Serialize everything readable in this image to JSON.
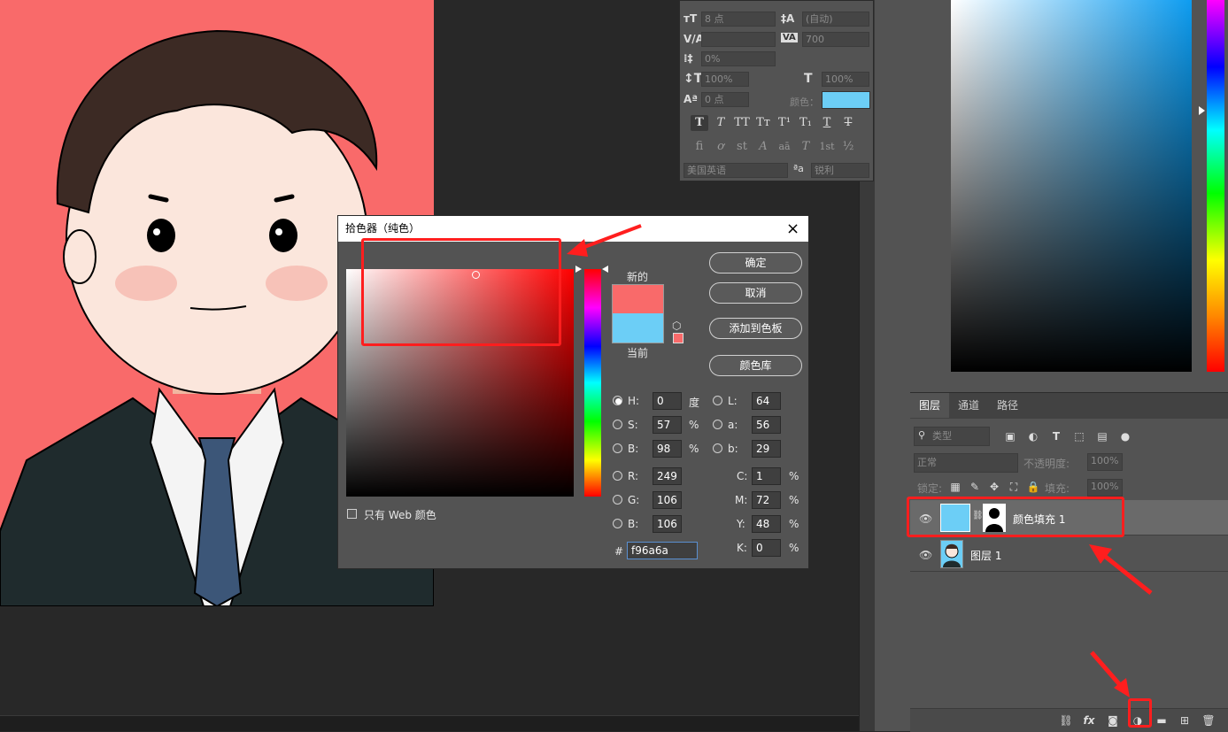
{
  "character_panel": {
    "font_size": "8 点",
    "leading": "(自动)",
    "tracking": "700",
    "scale_percent": "0%",
    "vertical_scale": "100%",
    "horizontal_scale": "100%",
    "baseline_shift": "0 点",
    "color_label": "颜色：",
    "color_swatch": "#6ccef6",
    "style_buttons": [
      "T",
      "T",
      "TT",
      "Tт",
      "T¹",
      "T₁",
      "T",
      "T"
    ],
    "opentype_buttons": [
      "fi",
      "ơ",
      "st",
      "A",
      "aā",
      "T",
      "1st",
      "½"
    ],
    "language": "美国英语",
    "aa_icon": "ªa",
    "antialias": "锐利"
  },
  "color_picker": {
    "title": "拾色器（纯色）",
    "close": "×",
    "ok": "确定",
    "cancel": "取消",
    "add_to_swatches": "添加到色板",
    "color_libraries": "颜色库",
    "new_label": "新的",
    "current_label": "当前",
    "new_color": "#f96a6a",
    "current_color": "#6ccef6",
    "web_only_label": "只有 Web 颜色",
    "fields": {
      "H": {
        "label": "H:",
        "value": "0",
        "unit": "度"
      },
      "S": {
        "label": "S:",
        "value": "57",
        "unit": "%"
      },
      "Bv": {
        "label": "B:",
        "value": "98",
        "unit": "%"
      },
      "R": {
        "label": "R:",
        "value": "249"
      },
      "G": {
        "label": "G:",
        "value": "106"
      },
      "Bl": {
        "label": "B:",
        "value": "106"
      },
      "L": {
        "label": "L:",
        "value": "64"
      },
      "a": {
        "label": "a:",
        "value": "56"
      },
      "b": {
        "label": "b:",
        "value": "29"
      },
      "C": {
        "label": "C:",
        "value": "1",
        "unit": "%"
      },
      "M": {
        "label": "M:",
        "value": "72",
        "unit": "%"
      },
      "Y": {
        "label": "Y:",
        "value": "48",
        "unit": "%"
      },
      "K": {
        "label": "K:",
        "value": "0",
        "unit": "%"
      },
      "hex_label": "#",
      "hex": "f96a6a"
    }
  },
  "layers_panel": {
    "tabs": [
      "图层",
      "通道",
      "路径"
    ],
    "filter_kind": "类型",
    "blend_mode": "正常",
    "opacity_label": "不透明度:",
    "opacity": "100%",
    "lock_label": "锁定:",
    "fill_label": "填充:",
    "fill": "100%",
    "layers": [
      {
        "name": "颜色填充 1",
        "selected": true
      },
      {
        "name": "图层 1",
        "selected": false
      }
    ],
    "bottom_icons": [
      "link-icon",
      "fx-icon",
      "mask-icon",
      "adjustment-icon",
      "folder-icon",
      "new-layer-icon",
      "trash-icon"
    ],
    "fx_label": "fx"
  },
  "canvas": {
    "background_color": "#f96a6a"
  },
  "colors": {
    "annotation_red": "#ff1e1e",
    "panel_bg": "#535353"
  }
}
